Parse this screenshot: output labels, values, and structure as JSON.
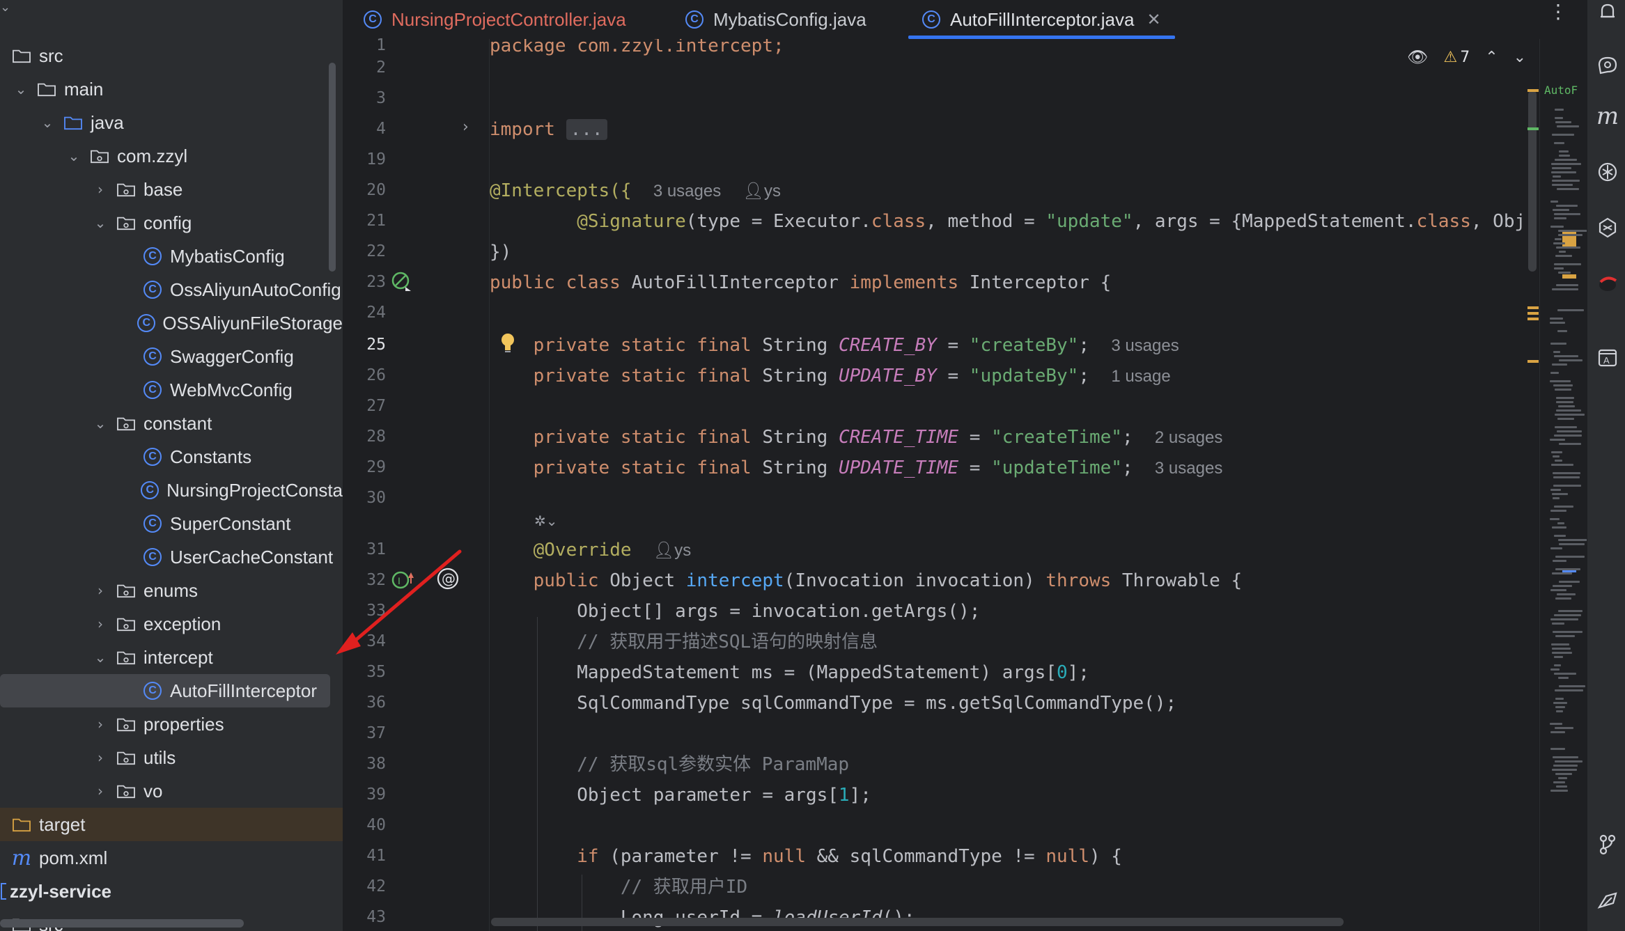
{
  "tabs": [
    {
      "label": "NursingProjectController.java",
      "state": "modified"
    },
    {
      "label": "MybatisConfig.java",
      "state": "normal"
    },
    {
      "label": "AutoFillInterceptor.java",
      "state": "active"
    }
  ],
  "tree": [
    {
      "label": "src",
      "icon": "folder",
      "chev": ""
    },
    {
      "label": "main",
      "icon": "folder",
      "chev": "down"
    },
    {
      "label": "java",
      "icon": "source-folder",
      "chev": "down"
    },
    {
      "label": "com.zzyl",
      "icon": "package",
      "chev": "down"
    },
    {
      "label": "base",
      "icon": "package",
      "chev": "right"
    },
    {
      "label": "config",
      "icon": "package",
      "chev": "down"
    },
    {
      "label": "MybatisConfig",
      "icon": "class"
    },
    {
      "label": "OssAliyunAutoConfig",
      "icon": "class"
    },
    {
      "label": "OSSAliyunFileStorage",
      "icon": "class"
    },
    {
      "label": "SwaggerConfig",
      "icon": "class"
    },
    {
      "label": "WebMvcConfig",
      "icon": "class"
    },
    {
      "label": "constant",
      "icon": "package",
      "chev": "down"
    },
    {
      "label": "Constants",
      "icon": "class"
    },
    {
      "label": "NursingProjectConsta",
      "icon": "class"
    },
    {
      "label": "SuperConstant",
      "icon": "class"
    },
    {
      "label": "UserCacheConstant",
      "icon": "class"
    },
    {
      "label": "enums",
      "icon": "package",
      "chev": "right"
    },
    {
      "label": "exception",
      "icon": "package",
      "chev": "right"
    },
    {
      "label": "intercept",
      "icon": "package",
      "chev": "down"
    },
    {
      "label": "AutoFillInterceptor",
      "icon": "class",
      "selected": true
    },
    {
      "label": "properties",
      "icon": "package",
      "chev": "right"
    },
    {
      "label": "utils",
      "icon": "package",
      "chev": "right"
    },
    {
      "label": "vo",
      "icon": "package",
      "chev": "right"
    },
    {
      "label": "target",
      "icon": "excluded-folder"
    },
    {
      "label": "pom.xml",
      "icon": "maven"
    },
    {
      "label": "zzyl-service",
      "icon": "module"
    },
    {
      "label": "src",
      "icon": "folder"
    }
  ],
  "inspection": {
    "warnings": "7"
  },
  "gutter": {
    "line_numbers": [
      "1",
      "2",
      "3",
      "4",
      "19",
      "20",
      "21",
      "22",
      "23",
      "24",
      "25",
      "26",
      "27",
      "28",
      "29",
      "30",
      "",
      "31",
      "32",
      "33",
      "34",
      "35",
      "36",
      "37",
      "38",
      "39",
      "40",
      "41",
      "42",
      "43"
    ],
    "current_line": "25"
  },
  "code": {
    "l1": "package com.zzyl.intercept;",
    "l4_import": "import",
    "l4_fold": "...",
    "l20_ann": "@Intercepts({",
    "l20_hint": "3 usages",
    "l20_author": "ys",
    "l21_pre": "@Signature",
    "l21_a": "(type = Executor.",
    "l21_b": "class",
    "l21_c": ", method = ",
    "l21_d": "\"update\"",
    "l21_e": ", args = {MappedStatement.",
    "l21_f": "class",
    "l21_g": ", Obj",
    "l22": "})",
    "l23_kw": "public class",
    "l23_name": " AutoFillInterceptor ",
    "l23_kw2": "implements",
    "l23_rest": " Interceptor {",
    "l25_kw": "private static final",
    "l25_type": " String ",
    "l25_name": "CREATE_BY",
    "l25_eq": " = ",
    "l25_val": "\"createBy\"",
    "l25_semi": ";",
    "l25_hint": "3 usages",
    "l26_name": "UPDATE_BY",
    "l26_val": "\"updateBy\"",
    "l26_hint": "1 usage",
    "l28_name": "CREATE_TIME",
    "l28_val": "\"createTime\"",
    "l28_hint": "2 usages",
    "l29_name": "UPDATE_TIME",
    "l29_val": "\"updateTime\"",
    "l29_hint": "3 usages",
    "l31_ann": "@Override",
    "l31_author": "ys",
    "l32_kw": "public",
    "l32_type": " Object ",
    "l32_fn": "intercept",
    "l32_params": "(Invocation invocation) ",
    "l32_throws": "throws",
    "l32_rest": " Throwable {",
    "l33": "Object[] args = invocation.getArgs();",
    "l34": "// 获取用于描述SQL语句的映射信息",
    "l35_a": "MappedStatement ms = (MappedStatement) args[",
    "l35_num": "0",
    "l35_b": "];",
    "l36": "SqlCommandType sqlCommandType = ms.getSqlCommandType();",
    "l38": "// 获取sql参数实体 ParamMap",
    "l39_a": "Object parameter = args[",
    "l39_num": "1",
    "l39_b": "];",
    "l41_if": "if",
    "l41_a": " (parameter != ",
    "l41_null": "null",
    "l41_b": " && sqlCommandType != ",
    "l41_null2": "null",
    "l41_c": ") {",
    "l42": "// 获取用户ID",
    "l43_a": "Long userId = ",
    "l43_fn": "loadUserId",
    "l43_b": "();"
  },
  "minimap_label": "AutoF",
  "colors": {
    "accent": "#3574f0",
    "keyword": "#cf8e6d",
    "string": "#6aab73",
    "constant": "#c77dbb",
    "annotation": "#b3ae60",
    "arrow": "#e0201f"
  }
}
